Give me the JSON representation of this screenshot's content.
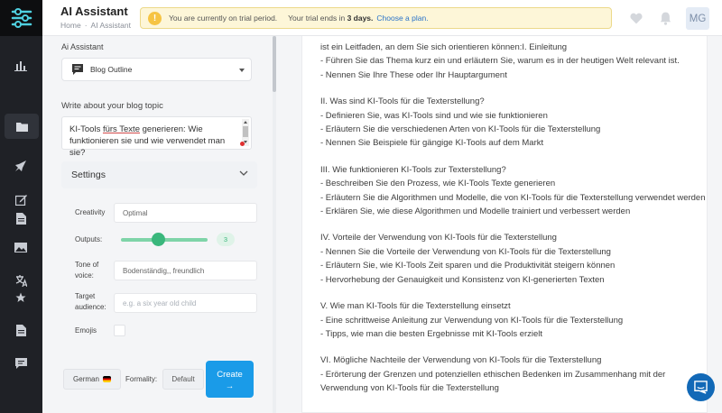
{
  "header": {
    "title": "AI Assistant",
    "breadcrumb": [
      "Home",
      "AI Assistant"
    ],
    "breadcrumb_sep": "·",
    "trial": {
      "text_a": "You are currently on trial period.",
      "text_b": "Your trial ends in",
      "days": "3 days.",
      "link": "Choose a plan."
    },
    "avatar_initials": "MG"
  },
  "rail": {
    "icons": [
      "chart-icon",
      "folder-icon",
      "rocket-icon",
      "edit-icon",
      "document-icon",
      "image-icon",
      "translate-icon",
      "star-icon",
      "file-icon",
      "chat-icon"
    ],
    "active": "folder-icon"
  },
  "panel": {
    "assistant_label": "Ai Assistant",
    "template_value": "Blog Outline",
    "topic_label": "Write about your blog topic",
    "topic_text_pre": "KI-Tools ",
    "topic_text_underlined": "fürs Texte",
    "topic_text_post": " generieren: Wie funktionieren sie und wie verwendet man sie?",
    "settings_label": "Settings",
    "creativity_label": "Creativity",
    "creativity_value": "Optimal",
    "outputs_label": "Outputs:",
    "outputs_value": "3",
    "outputs_fraction": 0.45,
    "tone_label": "Tone of voice:",
    "tone_value": "Bodenständig,, freundlich",
    "audience_label": "Target audience:",
    "audience_placeholder": "e.g. a six year old child",
    "emojis_label": "Emojis",
    "language": "German",
    "formality_label": "Formality:",
    "formality_value": "Default",
    "create_label": "Create",
    "create_arrow": "→"
  },
  "document": {
    "paragraphs": [
      "ist ein Leitfaden, an dem Sie sich orientieren können:I. Einleitung\n- Führen Sie das Thema kurz ein und erläutern Sie, warum es in der heutigen Welt relevant ist.\n- Nennen Sie Ihre These oder Ihr Hauptargument",
      "II. Was sind KI-Tools für die Texterstellung?\n- Definieren Sie, was KI-Tools sind und wie sie funktionieren\n- Erläutern Sie die verschiedenen Arten von KI-Tools für die Texterstellung\n- Nennen Sie Beispiele für gängige KI-Tools auf dem Markt",
      "III. Wie funktionieren KI-Tools zur Texterstellung?\n- Beschreiben Sie den Prozess, wie KI-Tools Texte generieren\n- Erläutern Sie die Algorithmen und Modelle, die von KI-Tools für die Texterstellung verwendet werden\n- Erklären Sie, wie diese Algorithmen und Modelle trainiert und verbessert werden",
      "IV. Vorteile der Verwendung von KI-Tools für die Texterstellung\n- Nennen Sie die Vorteile der Verwendung von KI-Tools für die Texterstellung\n- Erläutern Sie, wie KI-Tools Zeit sparen und die Produktivität steigern können\n- Hervorhebung der Genauigkeit und Konsistenz von KI-generierten Texten",
      "V. Wie man KI-Tools für die Texterstellung einsetzt\n- Eine schrittweise Anleitung zur Verwendung von KI-Tools für die Texterstellung\n- Tipps, wie man die besten Ergebnisse mit KI-Tools erzielt",
      "VI. Mögliche Nachteile der Verwendung von KI-Tools für die Texterstellung\n- Erörterung der Grenzen und potenziellen ethischen Bedenken im Zusammenhang mit der Verwendung von KI-Tools für die Texterstellung"
    ]
  },
  "colors": {
    "rail_bg": "#1f2126",
    "accent_blue": "#1a9be8",
    "slider_green": "#3ab77c",
    "trial_bg": "#fdf6d8"
  }
}
